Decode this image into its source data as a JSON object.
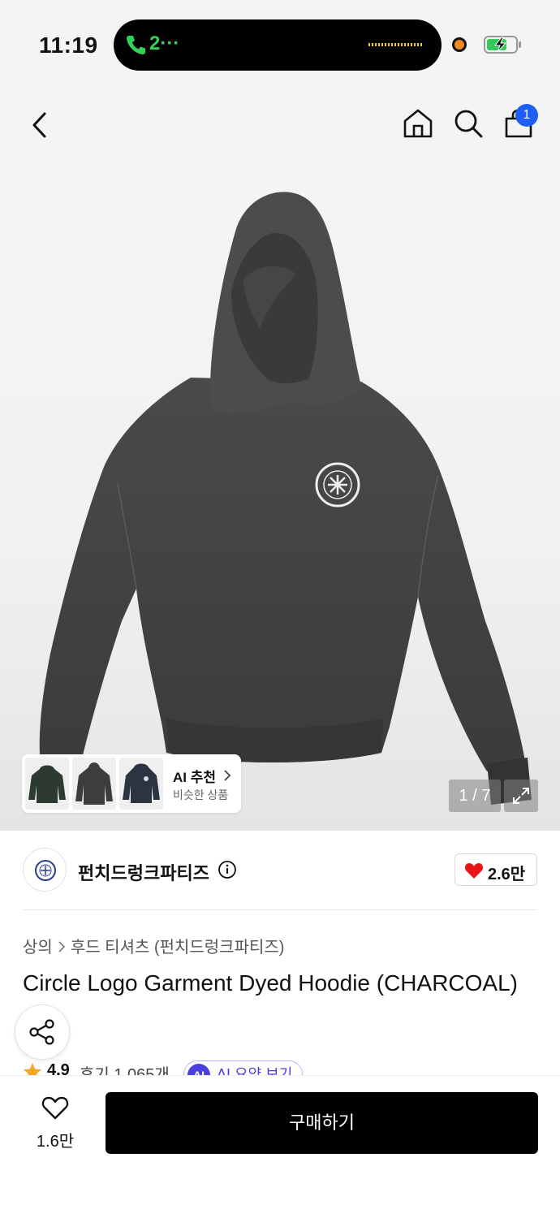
{
  "status_bar": {
    "time": "11:19",
    "call_text": "2···",
    "icons": [
      "phone-icon",
      "recording-dot-icon",
      "battery-charging-icon"
    ]
  },
  "header": {
    "icons": [
      "back-icon",
      "home-icon",
      "search-icon",
      "cart-icon"
    ],
    "cart_badge": "1"
  },
  "product_image": {
    "ai_recommend": {
      "title": "AI 추천",
      "subtitle": "비슷한 상품"
    },
    "page_counter": "1 / 7"
  },
  "brand": {
    "name": "펀치드렁크파티즈",
    "likes": "2.6만"
  },
  "breadcrumb": {
    "category": "상의",
    "subcategory": "후드 티셔츠 (펀치드렁크파티즈)"
  },
  "product": {
    "title": "Circle Logo Garment Dyed Hoodie (CHARCOAL)",
    "rating": "4.9",
    "reviews": "후기 1,065개",
    "ai_summary": "AI 요약 보기",
    "ai_badge": "AI"
  },
  "bottom_bar": {
    "wish_count": "1.6만",
    "buy_label": "구매하기"
  },
  "colors": {
    "accent_blue": "#1f5ef5",
    "ai_purple": "#4b3fe0",
    "heart_red": "#e8151b",
    "star_orange": "#f5a623",
    "buy_black": "#000000"
  }
}
